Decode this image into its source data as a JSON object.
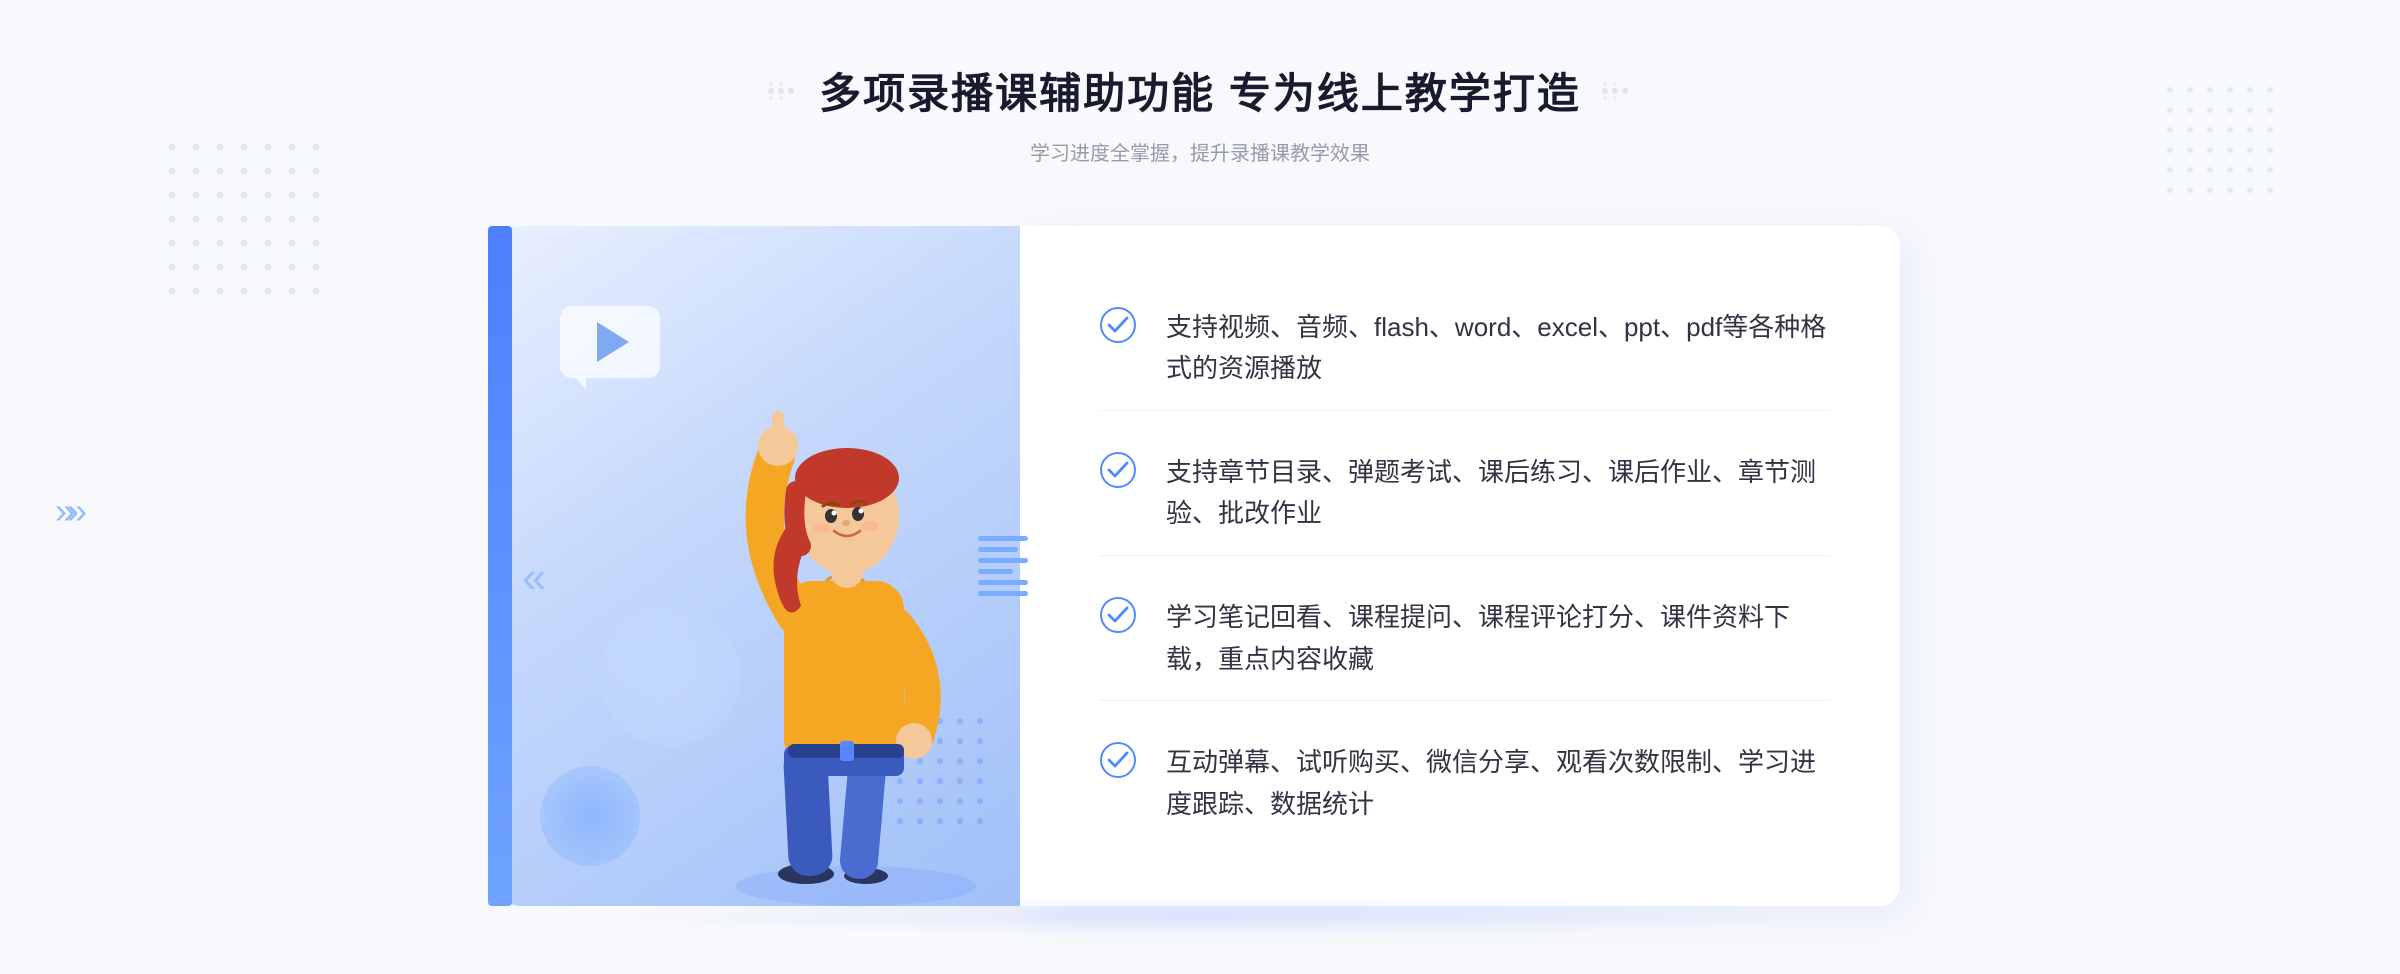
{
  "header": {
    "title": "多项录播课辅助功能 专为线上教学打造",
    "subtitle": "学习进度全掌握，提升录播课教学效果",
    "deco_left": "⁝⁝",
    "deco_right": "⁝⁝"
  },
  "features": [
    {
      "id": "feature-1",
      "text": "支持视频、音频、flash、word、excel、ppt、pdf等各种格式的资源播放"
    },
    {
      "id": "feature-2",
      "text": "支持章节目录、弹题考试、课后练习、课后作业、章节测验、批改作业"
    },
    {
      "id": "feature-3",
      "text": "学习笔记回看、课程提问、课程评论打分、课件资料下载，重点内容收藏"
    },
    {
      "id": "feature-4",
      "text": "互动弹幕、试听购买、微信分享、观看次数限制、学习进度跟踪、数据统计"
    }
  ],
  "colors": {
    "primary": "#4d8cff",
    "title": "#1a1a2e",
    "subtitle": "#999aaa",
    "text": "#333344",
    "bg": "#f8f9fc",
    "panel_bg": "#ffffff",
    "illus_bg_start": "#e8f0fe",
    "illus_bg_end": "#a0c0f8"
  }
}
